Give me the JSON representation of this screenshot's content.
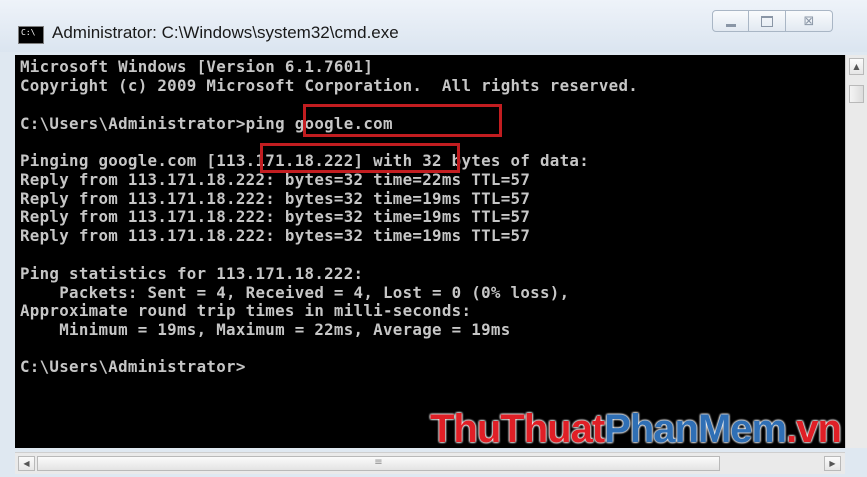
{
  "window": {
    "title": "Administrator: C:\\Windows\\system32\\cmd.exe",
    "icon": "console-app-icon",
    "icon_text": "C:\\"
  },
  "controls": {
    "minimize_icon": "minimize-icon",
    "maximize_icon": "maximize-icon",
    "close_icon": "close-icon",
    "close_glyph": "⊠"
  },
  "console": {
    "background": "#000000",
    "text_color": "#c6c6c6",
    "lines": [
      "Microsoft Windows [Version 6.1.7601]",
      "Copyright (c) 2009 Microsoft Corporation.  All rights reserved.",
      "",
      "C:\\Users\\Administrator>ping google.com",
      "",
      "Pinging google.com [113.171.18.222] with 32 bytes of data:",
      "Reply from 113.171.18.222: bytes=32 time=22ms TTL=57",
      "Reply from 113.171.18.222: bytes=32 time=19ms TTL=57",
      "Reply from 113.171.18.222: bytes=32 time=19ms TTL=57",
      "Reply from 113.171.18.222: bytes=32 time=19ms TTL=57",
      "",
      "Ping statistics for 113.171.18.222:",
      "    Packets: Sent = 4, Received = 4, Lost = 0 (0% loss),",
      "Approximate round trip times in milli-seconds:",
      "    Minimum = 19ms, Maximum = 22ms, Average = 19ms",
      "",
      "C:\\Users\\Administrator>"
    ],
    "highlight_color": "#c21d20",
    "highlights": [
      "ping google.com",
      "[113.171.18.222]"
    ]
  },
  "watermark": {
    "part1": "ThuThuat",
    "part2": "PhanMem",
    "part3": ".vn",
    "color_red": "#e01f26",
    "color_blue": "#2f6fb5"
  },
  "scrollbars": {
    "up_glyph": "▲",
    "down_glyph": "▼",
    "left_glyph": "◀",
    "right_glyph": "▶",
    "grip_glyph": "≡"
  }
}
